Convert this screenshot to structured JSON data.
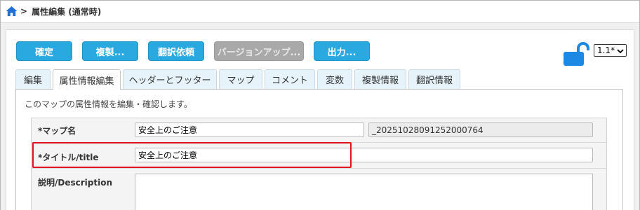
{
  "breadcrumb": {
    "home_icon": "home-icon",
    "separator": ">",
    "current": "属性編集 (通常時)"
  },
  "toolbar": {
    "confirm_label": "確定",
    "duplicate_label": "複製...",
    "translate_request_label": "翻訳依頼",
    "version_up_label": "バージョンアップ...",
    "output_label": "出力...",
    "lock_icon": "unlock-icon",
    "version_value": "1.1*"
  },
  "tabs": [
    {
      "label": "編集"
    },
    {
      "label": "属性情報編集"
    },
    {
      "label": "ヘッダーとフッター"
    },
    {
      "label": "マップ"
    },
    {
      "label": "コメント"
    },
    {
      "label": "変数"
    },
    {
      "label": "複製情報"
    },
    {
      "label": "翻訳情報"
    }
  ],
  "description": "このマップの属性情報を編集・確認します。",
  "form": {
    "map_name_label": "*マップ名",
    "map_name_value": "安全上のご注意",
    "map_id_value": "_20251028091252000764",
    "title_label": "*タイトル/title",
    "title_value": "安全上のご注意",
    "description_label": "説明/Description",
    "description_value": ""
  },
  "colors": {
    "button": "#29a9e0",
    "button_disabled": "#a9a9a9",
    "tab_bg": "#e6f3fb",
    "highlight": "#e0141e",
    "lock": "#1e88e5"
  }
}
